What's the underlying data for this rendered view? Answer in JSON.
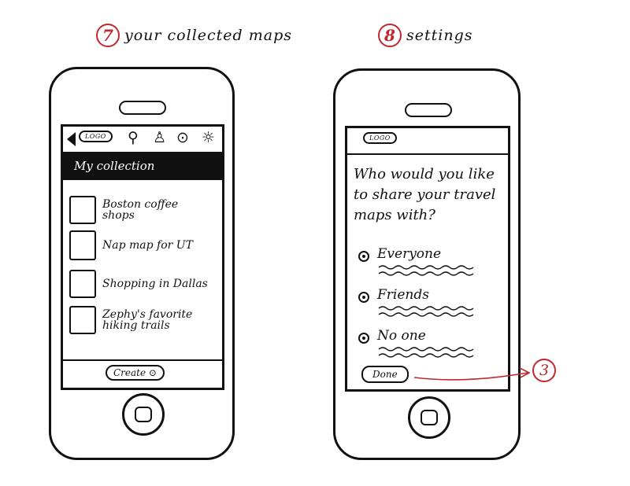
{
  "left_panel": {
    "step_number": "7",
    "heading": "your collected maps",
    "logo": "LOGO",
    "icons": [
      "back-arrow-icon",
      "search-icon",
      "person-icon",
      "map-pin-icon",
      "sun-settings-icon"
    ],
    "section_title": "My collection",
    "items": [
      {
        "label": "Boston coffee shops"
      },
      {
        "label": "Nap map for UT"
      },
      {
        "label": "Shopping in Dallas"
      },
      {
        "label": "Zephy's favorite hiking trails"
      }
    ],
    "create_button": "Create"
  },
  "right_panel": {
    "step_number": "8",
    "heading": "settings",
    "logo": "LOGO",
    "question": "Who would you like to share your travel maps with?",
    "options": [
      {
        "label": "Everyone"
      },
      {
        "label": "Friends"
      },
      {
        "label": "No one"
      }
    ],
    "done_button": "Done",
    "callout_number": "3"
  },
  "colors": {
    "accent": "#c0282f",
    "ink": "#111111",
    "paper": "#ffffff"
  }
}
